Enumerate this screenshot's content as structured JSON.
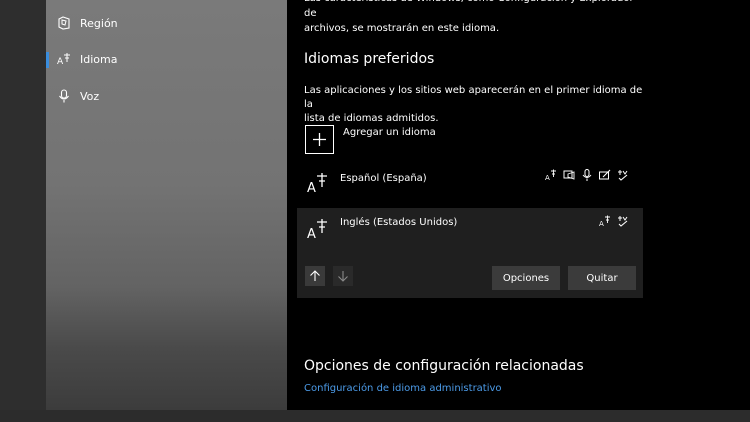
{
  "sidebar": {
    "items": [
      {
        "label": "Región",
        "icon": "region-icon"
      },
      {
        "label": "Idioma",
        "icon": "language-icon",
        "selected": true
      },
      {
        "label": "Voz",
        "icon": "microphone-icon"
      }
    ]
  },
  "intro": {
    "line1": "Las características de Windows, como Configuración y Explorador de",
    "line2": "archivos, se mostrarán en este idioma."
  },
  "preferred": {
    "title": "Idiomas preferidos",
    "desc_line1": "Las aplicaciones y los sitios web aparecerán en el primer idioma de la",
    "desc_line2": "lista de idiomas admitidos.",
    "add_label": "Agregar un idioma",
    "languages": [
      {
        "name": "Español (España)"
      },
      {
        "name": "Inglés (Estados Unidos)"
      }
    ],
    "options_button": "Opciones",
    "remove_button": "Quitar"
  },
  "related": {
    "title": "Opciones de configuración relacionadas",
    "link": "Configuración de idioma administrativo"
  },
  "colors": {
    "accent": "#3a8ddd",
    "link": "#4c9be8",
    "content_bg": "#000000"
  }
}
